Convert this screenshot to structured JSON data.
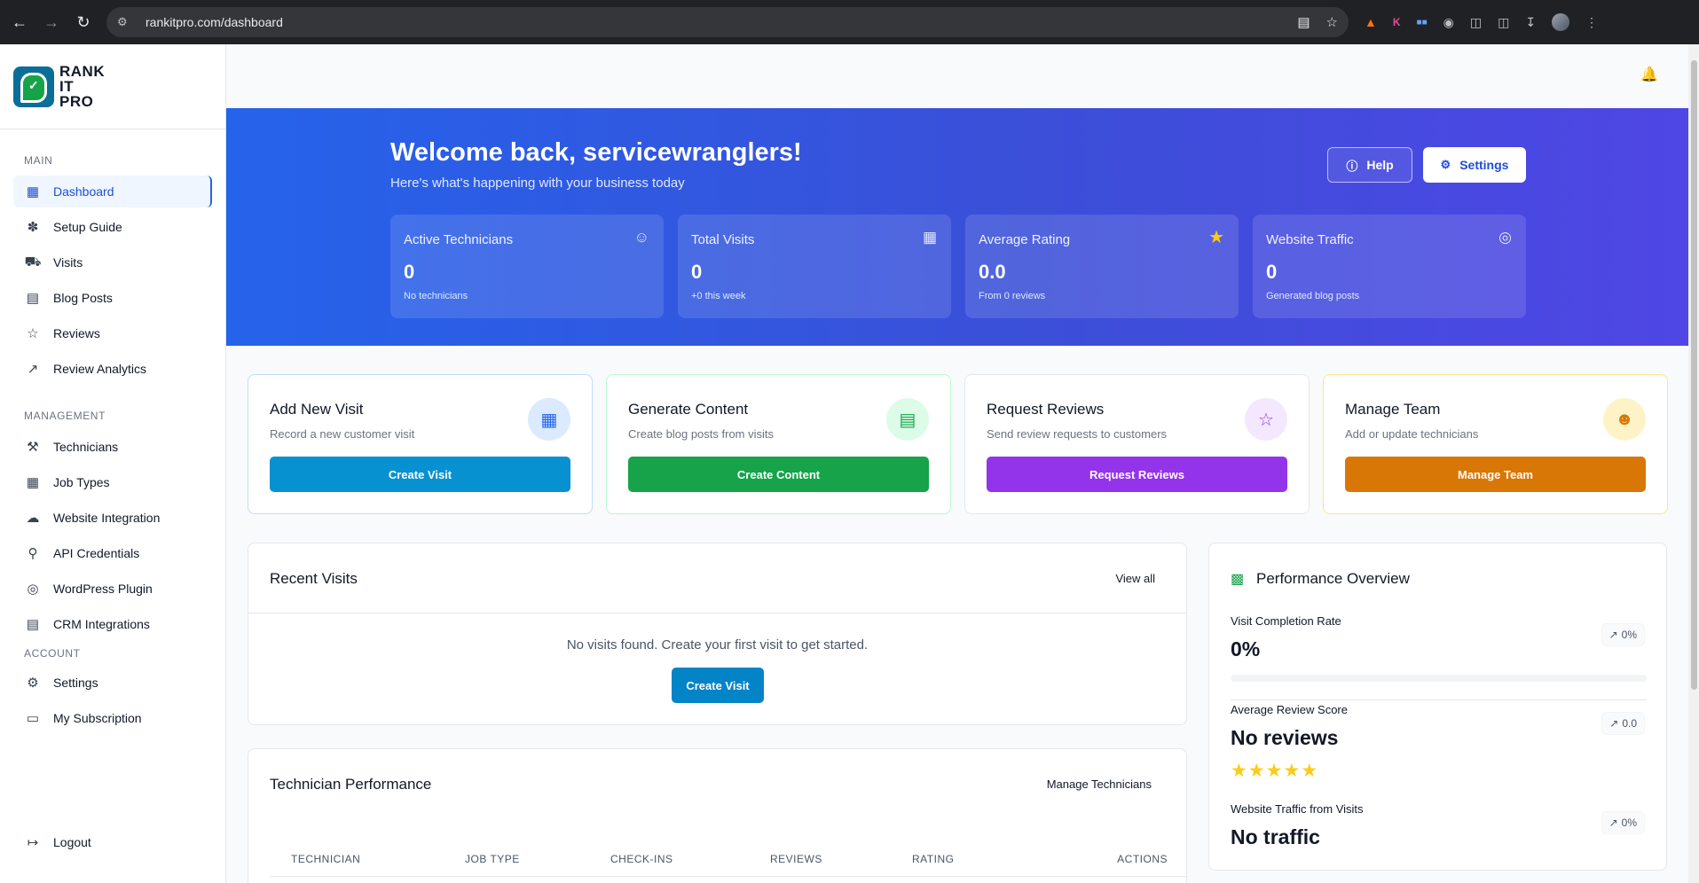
{
  "browser": {
    "url": "rankitpro.com/dashboard"
  },
  "brand": {
    "line1": "RANK",
    "line2": "IT",
    "line3": "PRO"
  },
  "sidebar": {
    "main_label": "MAIN",
    "main_items": [
      {
        "label": "Dashboard",
        "icon": "dashboard-icon",
        "active": true
      },
      {
        "label": "Setup Guide",
        "icon": "setup-icon"
      },
      {
        "label": "Visits",
        "icon": "car-icon"
      },
      {
        "label": "Blog Posts",
        "icon": "file-icon"
      },
      {
        "label": "Reviews",
        "icon": "star-icon"
      },
      {
        "label": "Review Analytics",
        "icon": "chart-line-icon"
      }
    ],
    "management_label": "MANAGEMENT",
    "management_items": [
      {
        "label": "Technicians",
        "icon": "wrench-icon"
      },
      {
        "label": "Job Types",
        "icon": "grid-icon"
      },
      {
        "label": "Website Integration",
        "icon": "cloud-icon"
      },
      {
        "label": "API Credentials",
        "icon": "lock-icon"
      },
      {
        "label": "WordPress Plugin",
        "icon": "globe-icon"
      },
      {
        "label": "CRM Integrations",
        "icon": "clipboard-icon"
      }
    ],
    "account_label": "ACCOUNT",
    "account_items": [
      {
        "label": "Settings",
        "icon": "gear-icon"
      },
      {
        "label": "My Subscription",
        "icon": "card-icon"
      }
    ],
    "logout_label": "Logout"
  },
  "hero": {
    "title": "Welcome back, servicewranglers!",
    "subtitle": "Here's what's happening with your business today",
    "help_label": "Help",
    "settings_label": "Settings",
    "stats": [
      {
        "title": "Active Technicians",
        "value": "0",
        "note": "No technicians",
        "icon": "user-icon"
      },
      {
        "title": "Total Visits",
        "value": "0",
        "note": "+0 this week",
        "icon": "calendar-icon"
      },
      {
        "title": "Average Rating",
        "value": "0.0",
        "note": "From 0 reviews",
        "icon": "star-icon"
      },
      {
        "title": "Website Traffic",
        "value": "0",
        "note": "Generated blog posts",
        "icon": "globe-icon"
      }
    ]
  },
  "actions": [
    {
      "title": "Add New Visit",
      "desc": "Record a new customer visit",
      "button": "Create Visit",
      "color": "#0891d1",
      "icon": "calendar-icon"
    },
    {
      "title": "Generate Content",
      "desc": "Create blog posts from visits",
      "button": "Create Content",
      "color": "#16a34a",
      "icon": "document-icon"
    },
    {
      "title": "Request Reviews",
      "desc": "Send review requests to customers",
      "button": "Request Reviews",
      "color": "#9333ea",
      "icon": "star-icon"
    },
    {
      "title": "Manage Team",
      "desc": "Add or update technicians",
      "button": "Manage Team",
      "color": "#d97706",
      "icon": "users-icon"
    }
  ],
  "recent_visits": {
    "title": "Recent Visits",
    "view_all": "View all",
    "empty": "No visits found. Create your first visit to get started.",
    "button": "Create Visit"
  },
  "technician_performance": {
    "title": "Technician Performance",
    "link": "Manage Technicians",
    "columns": [
      "TECHNICIAN",
      "JOB TYPE",
      "CHECK-INS",
      "REVIEWS",
      "RATING",
      "ACTIONS"
    ]
  },
  "performance": {
    "title": "Performance Overview",
    "completion_label": "Visit Completion Rate",
    "completion_value": "0%",
    "completion_trend": "0%",
    "completion_fraction": 0,
    "review_label": "Average Review Score",
    "review_value": "No reviews",
    "review_trend": "0.0",
    "traffic_label": "Website Traffic from Visits",
    "traffic_value": "No traffic",
    "traffic_trend": "0%"
  }
}
